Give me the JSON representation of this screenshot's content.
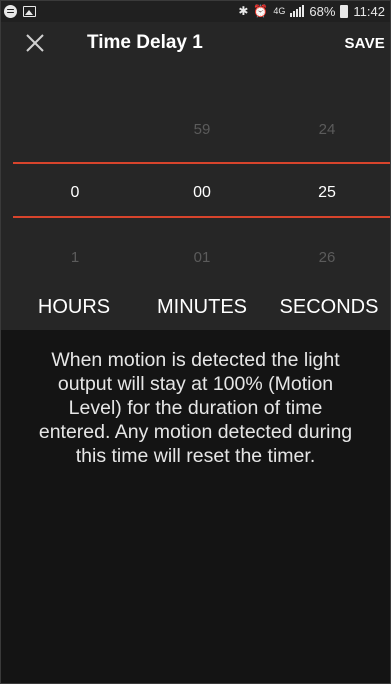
{
  "statusbar": {
    "battery": "68%",
    "time": "11:42",
    "network": "4G",
    "icons": [
      "spotify-icon",
      "gallery-icon",
      "bluetooth-icon",
      "alarm-icon",
      "network-4g-icon",
      "signal-icon",
      "battery-icon"
    ]
  },
  "header": {
    "title": "Time Delay 1",
    "save_label": "SAVE",
    "close_icon": "close-icon"
  },
  "picker": {
    "hours": {
      "above": "",
      "selected": "0",
      "below": "1",
      "label": "HOURS"
    },
    "minutes": {
      "above": "59",
      "selected": "00",
      "below": "01",
      "label": "MINUTES"
    },
    "seconds": {
      "above": "24",
      "selected": "25",
      "below": "26",
      "label": "SECONDS"
    }
  },
  "description": {
    "lines": [
      "When motion is detected the light",
      "output will stay at 100% (Motion",
      "Level) for the duration of time",
      "entered. Any motion detected during",
      "this time will reset the timer."
    ]
  },
  "colors": {
    "background": "#141414",
    "panel": "#262626",
    "accent": "#d8442c",
    "dim_text": "#5b5b5b"
  }
}
